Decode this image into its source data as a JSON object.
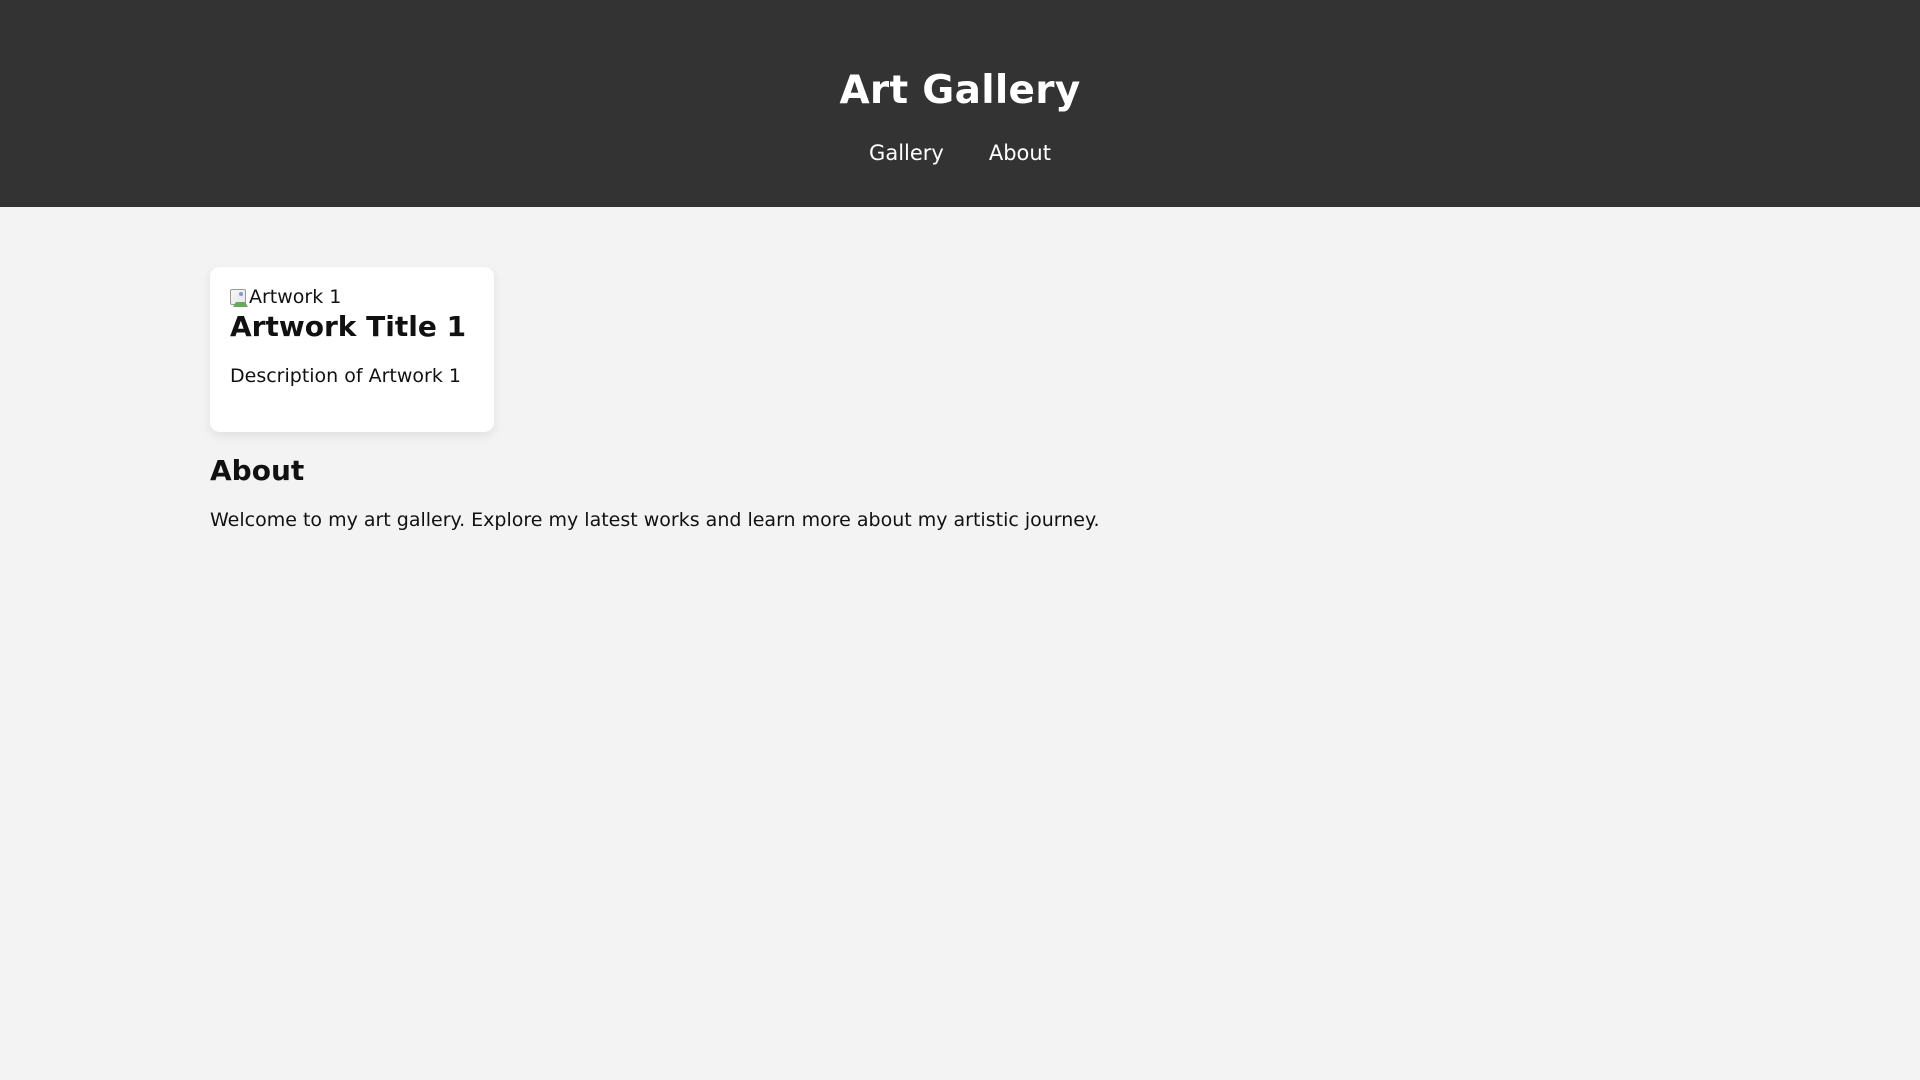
{
  "header": {
    "title": "Art Gallery",
    "nav": {
      "gallery_label": "Gallery",
      "about_label": "About"
    }
  },
  "gallery": {
    "items": [
      {
        "image_alt": "Artwork 1",
        "title": "Artwork Title 1",
        "description": "Description of Artwork 1",
        "image_icon": "broken-image-icon"
      }
    ]
  },
  "about": {
    "title": "About",
    "text": "Welcome to my art gallery. Explore my latest works and learn more about my artistic journey."
  },
  "colors": {
    "header_background": "#333333",
    "page_background": "#f3f3f3",
    "card_background": "#ffffff",
    "header_text": "#ffffff",
    "body_text": "#111111"
  }
}
